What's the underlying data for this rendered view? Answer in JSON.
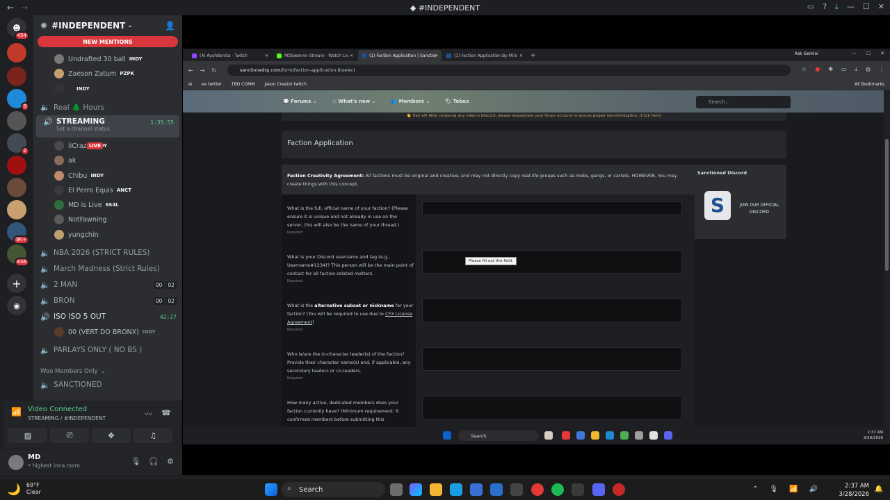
{
  "window": {
    "title": "#INDEPENDENT"
  },
  "rail": {
    "home_badge": "454",
    "servers": [
      {
        "name": "server-1",
        "color": "#c0392b",
        "badge": ""
      },
      {
        "name": "server-2",
        "color": "#7b241c",
        "badge": ""
      },
      {
        "name": "server-3",
        "color": "#1f8ad9",
        "badge": "9"
      },
      {
        "name": "server-4",
        "color": "#555555",
        "badge": ""
      },
      {
        "name": "server-5",
        "color": "#444a55",
        "badge": "2"
      },
      {
        "name": "server-6",
        "color": "#a01010",
        "badge": ""
      },
      {
        "name": "server-7",
        "color": "#6a4a3a",
        "badge": ""
      },
      {
        "name": "server-8",
        "color": "#c9a070",
        "badge": ""
      },
      {
        "name": "server-9",
        "color": "#335577",
        "badge": "9K+"
      },
      {
        "name": "server-10",
        "color": "#445533",
        "badge": "646"
      }
    ]
  },
  "channels": {
    "guild_name": "#INDEPENDENT",
    "new_mentions": "NEW MENTIONS",
    "top_users": [
      {
        "name": "Undrafted 30 ball",
        "tag": "INDY"
      },
      {
        "name": "Zaeson Zatum",
        "tag": "PZPK"
      },
      {
        "name": "",
        "tag": "INDY"
      }
    ],
    "real_hours": "Real 🌲 Hours",
    "streaming": {
      "name": "STREAMING",
      "timer": "1:35:55",
      "status": "Set a channel status"
    },
    "streaming_users": [
      {
        "name": "iiCrazy",
        "tag": "INDY",
        "live": "LIVE"
      },
      {
        "name": "ak",
        "tag": ""
      },
      {
        "name": "Chibu",
        "tag": "INDY"
      },
      {
        "name": "El Perro Equis",
        "tag": "ANCT"
      },
      {
        "name": "MD is Live",
        "tag": "SS4L"
      },
      {
        "name": "NotFawning",
        "tag": ""
      },
      {
        "name": "yungchin",
        "tag": ""
      }
    ],
    "list": [
      {
        "name": "NBA 2026 (STRICT RULES)"
      },
      {
        "name": "March Madness (Strict Rules)"
      },
      {
        "name": "2 MAN",
        "c1": "00",
        "c2": "02"
      },
      {
        "name": "BRON",
        "c1": "00",
        "c2": "02"
      },
      {
        "name": "ISO ISO 5 OUT",
        "timer": "42:27"
      }
    ],
    "iso_user": {
      "name": "00 (VERT DO BRONX)",
      "tag": "INDY"
    },
    "parlays": "PARLAYS ONLY ( NO BS )",
    "category": "Woo Members Only",
    "sanctioned": "SANCTIONED"
  },
  "voice": {
    "title": "Video Connected",
    "sub": "STREAMING / #INDEPENDENT"
  },
  "user": {
    "name": "MD",
    "status": "• highest inna room"
  },
  "browser": {
    "tabs": [
      {
        "label": "(4) AyahBonita - Twitch",
        "color": "#9146ff"
      },
      {
        "label": "MDSwervin Stream - Watch Liv",
        "color": "#53fc18"
      },
      {
        "label": "(1) Faction Application | Sanctio",
        "color": "#1d4f91"
      },
      {
        "label": "(1) Faction Application By Milo",
        "color": "#1d4f91"
      }
    ],
    "ask_gemini": "Ask Gemini",
    "url_domain": "sanctionedrp.com",
    "url_path": "/form/faction-application.8/select",
    "bookmarks": [
      "ex twitter",
      "TBD COMM",
      "Jason Creator twitch"
    ],
    "all_bookmarks": "All Bookmarks"
  },
  "forum": {
    "nav": [
      "Forums",
      "What's new",
      "Members",
      "Tebex"
    ],
    "search_placeholder": "Search...",
    "notice": "👋 Hey all! After receiving any roles in Discord, please reassociate your forum account to ensure proper synchronization. (Click here)",
    "card_title": "Faction Application",
    "agreement_bold": "Faction Creativity Agreement:",
    "agreement_text": " All factions must be original and creative, and may not directly copy real-life groups such as mobs, gangs, or cartels. HOWEVER, You may create things with this concept.",
    "side_title": "Sanctioned Discord",
    "side_join": "JOIN OUR OFFICIAL DISCORD",
    "tooltip": "Please fill out this field.",
    "required": "Required",
    "questions": [
      "What is the full, official name of your faction? (Please ensure it is unique and not already in use on the server, this will also be the name of your thread.)",
      "What is your Discord username and tag (e.g., Username#1234)? This person will be the main point of contact for all faction-related matters.",
      "What is the alternative subset or nickname for your faction? (You will be required to use due to CFX License Agreement)",
      "Who is/are the in-character leader(s) of the faction? Provide their character name(s) and, if applicable, any secondary leaders or co-leaders.",
      "How many active, dedicated members does your faction currently have? (Minimum requirement: 6 confirmed members before submitting this"
    ]
  },
  "stream_taskbar": {
    "search": "Search",
    "time": "2:37 AM",
    "date": "3/28/2026"
  },
  "taskbar": {
    "temp": "69°F",
    "cond": "Clear",
    "search": "Search",
    "time": "2:37 AM",
    "date": "3/28/2026"
  }
}
